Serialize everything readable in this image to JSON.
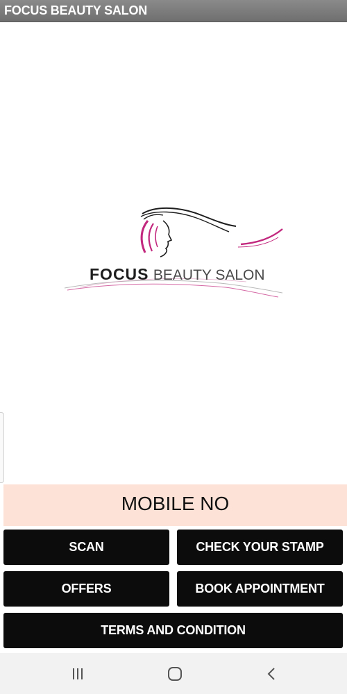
{
  "app": {
    "title": "FOCUS BEAUTY SALON"
  },
  "logo": {
    "bold_text": "FOCUS",
    "light_text": "BEAUTY SALON",
    "colors": {
      "accent": "#c2287e",
      "hair": "#1e1e1e"
    }
  },
  "mobile": {
    "label": "MOBILE NO"
  },
  "buttons": {
    "scan": "SCAN",
    "check_stamp": "CHECK YOUR STAMP",
    "offers": "OFFERS",
    "book_appointment": "BOOK APPOINTMENT",
    "terms": "TERMS AND CONDITION"
  },
  "navbar": {
    "recent_icon": "recent-apps-icon",
    "home_icon": "home-icon",
    "back_icon": "back-icon"
  },
  "colors": {
    "titlebar": "#7c7c7c",
    "banner": "#fde3d7",
    "button": "#0c0c0c",
    "navbar": "#f2f2f2"
  }
}
